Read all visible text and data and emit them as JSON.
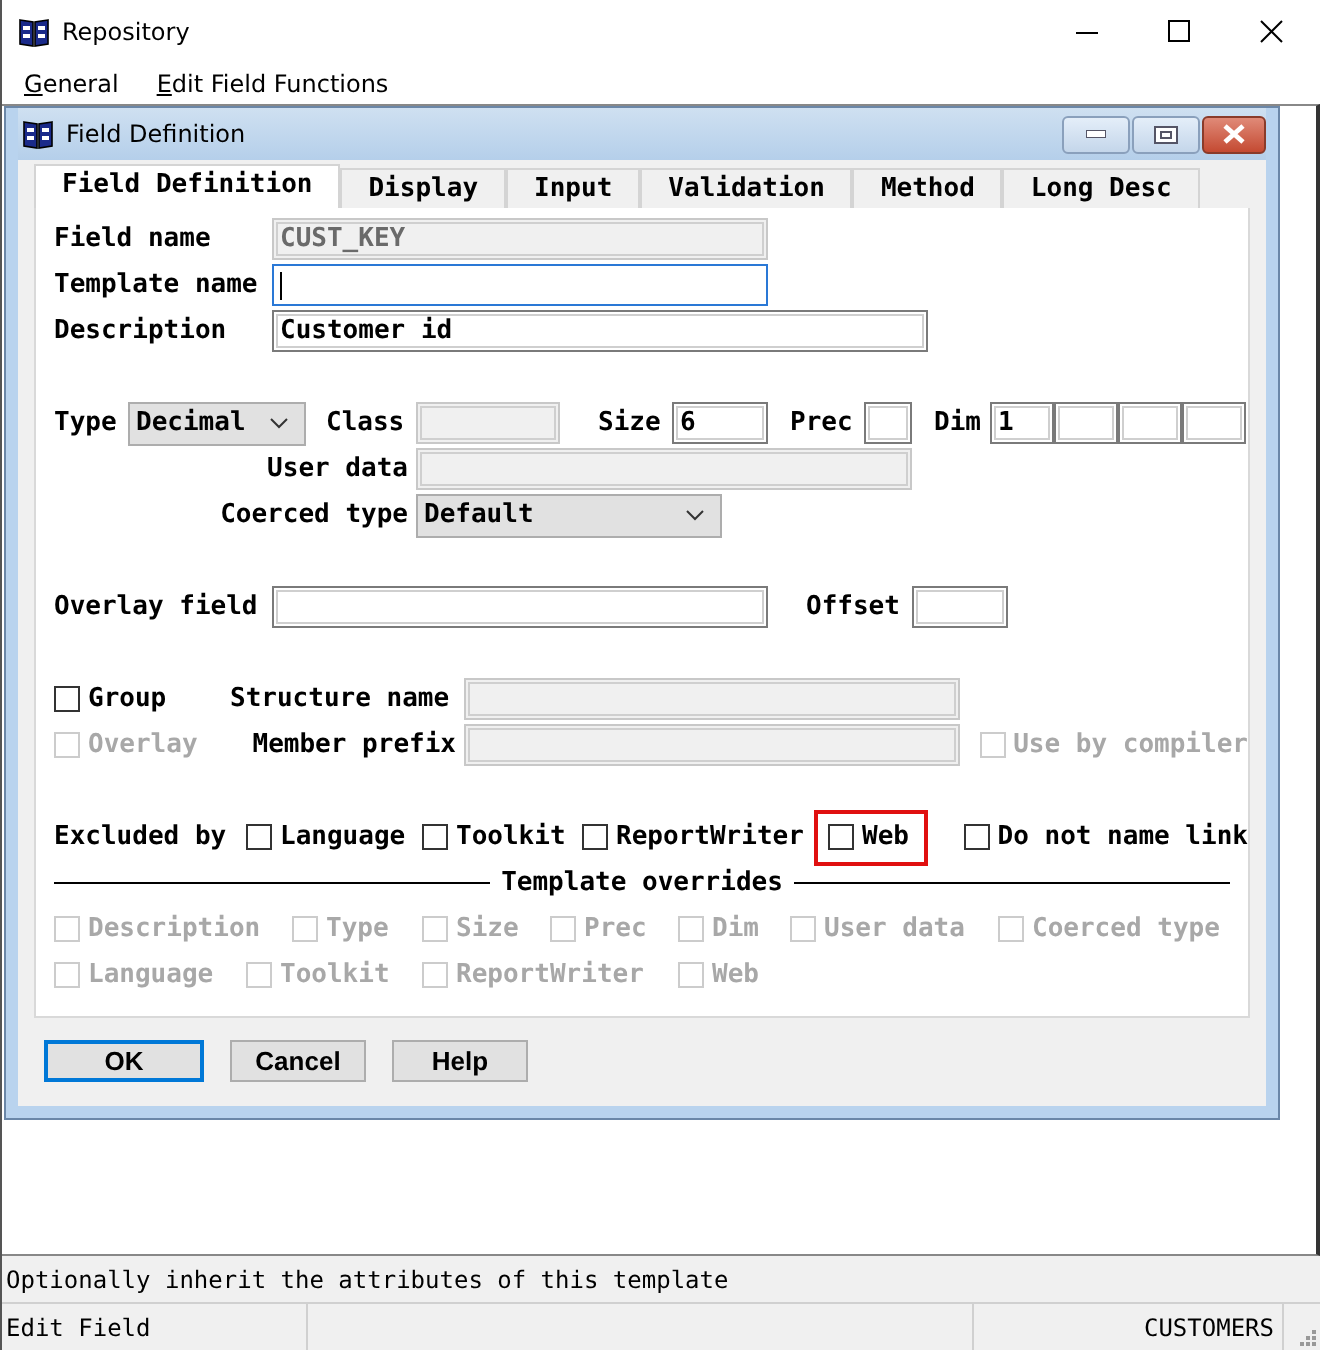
{
  "window": {
    "title": "Repository"
  },
  "menu": [
    {
      "label": "General"
    },
    {
      "label": "Edit Field Functions"
    }
  ],
  "dialog": {
    "title": "Field Definition",
    "tabs": [
      {
        "label": "Field Definition",
        "selected": true
      },
      {
        "label": "Display",
        "selected": false
      },
      {
        "label": "Input",
        "selected": false
      },
      {
        "label": "Validation",
        "selected": false
      },
      {
        "label": "Method",
        "selected": false
      },
      {
        "label": "Long Desc",
        "selected": false
      }
    ],
    "field_name": {
      "label": "Field name",
      "value": "CUST_KEY",
      "disabled": true
    },
    "template_name": {
      "label": "Template name",
      "focused": true
    },
    "description": {
      "label": "Description",
      "value": "Customer id"
    },
    "type": {
      "label": "Type",
      "value": "Decimal"
    },
    "class": {
      "label": "Class",
      "disabled": true
    },
    "size": {
      "label": "Size",
      "value": "6"
    },
    "prec": {
      "label": "Prec"
    },
    "dim": {
      "label": "Dim",
      "value": "1"
    },
    "user_data": {
      "label": "User data",
      "disabled": true
    },
    "coerced_type": {
      "label": "Coerced type",
      "value": "Default"
    },
    "overlay_field": {
      "label": "Overlay field"
    },
    "offset": {
      "label": "Offset"
    },
    "group": {
      "label": "Group",
      "checked": false,
      "disabled": false
    },
    "structure_name": {
      "label": "Structure name",
      "disabled": true
    },
    "overlay": {
      "label": "Overlay",
      "checked": false,
      "disabled": true
    },
    "member_prefix": {
      "label": "Member prefix",
      "disabled": true
    },
    "use_by_compiler": {
      "label": "Use by compiler",
      "checked": false,
      "disabled": true
    },
    "excluded_by": {
      "label": "Excluded by",
      "options": [
        {
          "label": "Language",
          "checked": false,
          "highlighted": false
        },
        {
          "label": "Toolkit",
          "checked": false,
          "highlighted": false
        },
        {
          "label": "ReportWriter",
          "checked": false,
          "highlighted": false
        },
        {
          "label": "Web",
          "checked": false,
          "highlighted": true
        }
      ]
    },
    "do_not_name_link": {
      "label": "Do not name link",
      "checked": false
    },
    "template_overrides": {
      "title": "Template overrides",
      "options": [
        {
          "label": "Description",
          "checked": false,
          "disabled": true
        },
        {
          "label": "Type",
          "checked": false,
          "disabled": true
        },
        {
          "label": "Size",
          "checked": false,
          "disabled": true
        },
        {
          "label": "Prec",
          "checked": false,
          "disabled": true
        },
        {
          "label": "Dim",
          "checked": false,
          "disabled": true
        },
        {
          "label": "User data",
          "checked": false,
          "disabled": true
        },
        {
          "label": "Coerced type",
          "checked": false,
          "disabled": true
        },
        {
          "label": "Language",
          "checked": false,
          "disabled": true
        },
        {
          "label": "Toolkit",
          "checked": false,
          "disabled": true
        },
        {
          "label": "ReportWriter",
          "checked": false,
          "disabled": true
        },
        {
          "label": "Web",
          "checked": false,
          "disabled": true
        }
      ]
    },
    "buttons": [
      {
        "label": "OK",
        "default": true
      },
      {
        "label": "Cancel",
        "default": false
      },
      {
        "label": "Help",
        "default": false
      }
    ]
  },
  "status_message": "Optionally inherit the attributes of this template",
  "status_bar": {
    "left": "Edit Field",
    "right": "CUSTOMERS"
  }
}
